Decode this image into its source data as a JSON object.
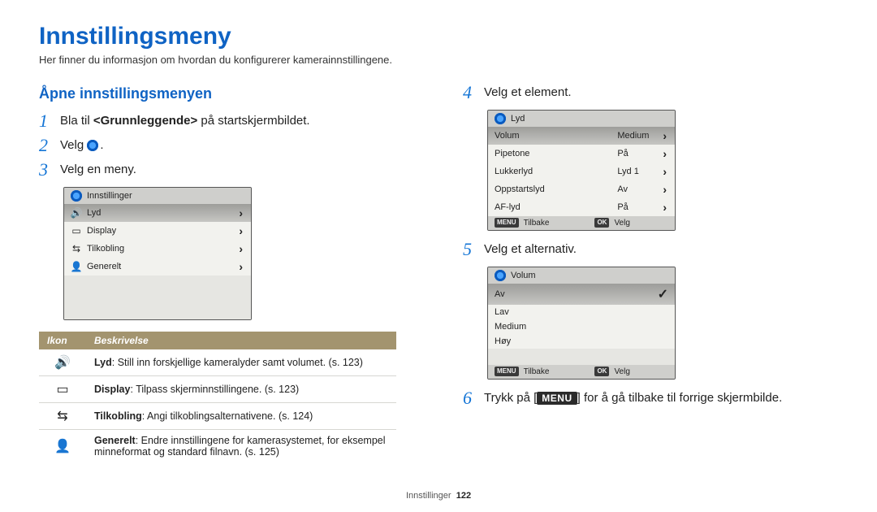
{
  "title": "Innstillingsmeny",
  "subtitle": "Her finner du informasjon om hvordan du konfigurerer kamerainnstillingene.",
  "left": {
    "heading": "Åpne innstillingsmenyen",
    "step1_pre": "Bla til ",
    "step1_bold": "<Grunnleggende>",
    "step1_post": " på startskjermbildet.",
    "step2_pre": "Velg ",
    "step2_post": ".",
    "step3": "Velg en meny.",
    "screen1": {
      "title": "Innstillinger",
      "items": [
        {
          "label": "Lyd"
        },
        {
          "label": "Display"
        },
        {
          "label": "Tilkobling"
        },
        {
          "label": "Generelt"
        }
      ]
    },
    "table": {
      "head_icon": "Ikon",
      "head_desc": "Beskrivelse",
      "rows": [
        {
          "name_bold": "Lyd",
          "desc": ": Still inn forskjellige kameralyder samt volumet. (s. 123)"
        },
        {
          "name_bold": "Display",
          "desc": ": Tilpass skjerminnstillingene. (s. 123)"
        },
        {
          "name_bold": "Tilkobling",
          "desc": ": Angi tilkoblingsalternativene. (s. 124)"
        },
        {
          "name_bold": "Generelt",
          "desc": ": Endre innstillingene for kamerasystemet, for eksempel minneformat og standard filnavn. (s. 125)"
        }
      ]
    }
  },
  "right": {
    "step4": "Velg et element.",
    "screen2": {
      "title": "Lyd",
      "rows": [
        {
          "label": "Volum",
          "value": "Medium",
          "highlight": true
        },
        {
          "label": "Pipetone",
          "value": "På"
        },
        {
          "label": "Lukkerlyd",
          "value": "Lyd 1"
        },
        {
          "label": "Oppstartslyd",
          "value": "Av"
        },
        {
          "label": "AF-lyd",
          "value": "På"
        }
      ],
      "footer_back_key": "MENU",
      "footer_back": "Tilbake",
      "footer_ok_key": "OK",
      "footer_ok": "Velg"
    },
    "step5": "Velg et alternativ.",
    "screen3": {
      "title": "Volum",
      "rows": [
        {
          "label": "Av",
          "selected": true
        },
        {
          "label": "Lav"
        },
        {
          "label": "Medium"
        },
        {
          "label": "Høy"
        }
      ],
      "footer_back_key": "MENU",
      "footer_back": "Tilbake",
      "footer_ok_key": "OK",
      "footer_ok": "Velg"
    },
    "step6_pre": "Trykk på [",
    "step6_key": "MENU",
    "step6_post": "] for å gå tilbake til forrige skjermbilde."
  },
  "footer": {
    "section": "Innstillinger",
    "page": "122"
  }
}
